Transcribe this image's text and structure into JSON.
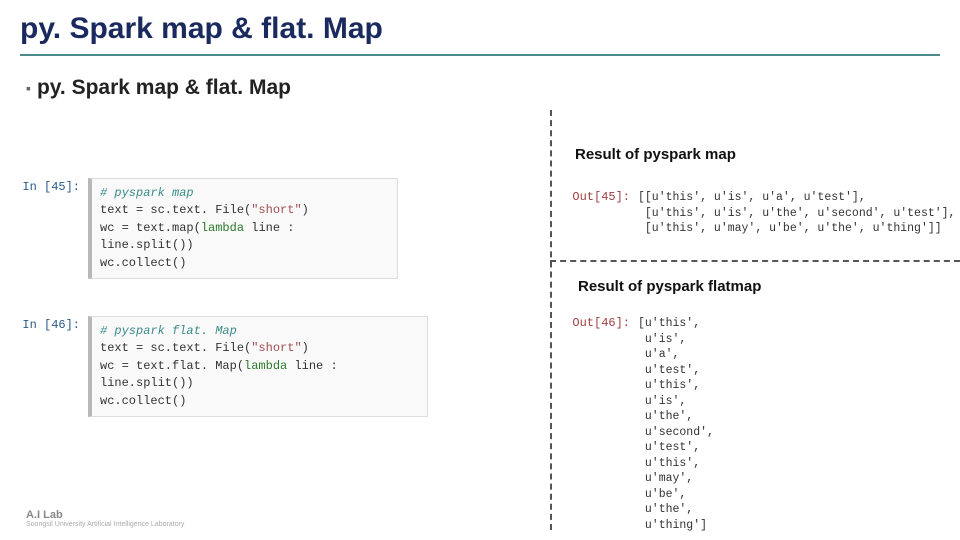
{
  "title": "py. Spark map & flat. Map",
  "subtitle": "py. Spark map & flat. Map",
  "labels": {
    "result_map": "Result of pyspark map",
    "result_flatmap": "Result of pyspark flatmap"
  },
  "prompts": {
    "in45": "In [45]:",
    "in46": "In [46]:",
    "out45": "Out[45]:",
    "out46": "Out[46]:"
  },
  "code": {
    "block45": {
      "c1": "# pyspark map",
      "l2a": "text = sc.text. File(",
      "l2b": "\"short\"",
      "l2c": ")",
      "l3a": "wc = text.map(",
      "l3b": "lambda",
      "l3c": " line : line.split())",
      "l4": "wc.collect()"
    },
    "block46": {
      "c1": "# pyspark flat. Map",
      "l2a": "text = sc.text. File(",
      "l2b": "\"short\"",
      "l2c": ")",
      "l3a": "wc = text.flat. Map(",
      "l3b": "lambda",
      "l3c": " line : line.split())",
      "l4": "wc.collect()"
    }
  },
  "output": {
    "out45": "[[u'this', u'is', u'a', u'test'],\n [u'this', u'is', u'the', u'second', u'test'],\n [u'this', u'may', u'be', u'the', u'thing']]",
    "out46": "[u'this',\n u'is',\n u'a',\n u'test',\n u'this',\n u'is',\n u'the',\n u'second',\n u'test',\n u'this',\n u'may',\n u'be',\n u'the',\n u'thing']"
  },
  "logo": {
    "main": "A.I Lab",
    "sub": "Soongsil University\nArtificial Intelligence Laboratory"
  }
}
